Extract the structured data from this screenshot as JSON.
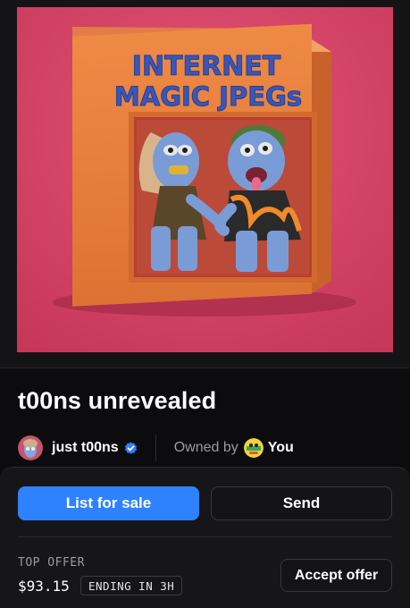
{
  "nft": {
    "box_text_line1": "INTERNET",
    "box_text_line2": "MAGIC JPEGs",
    "title": "t00ns unrevealed"
  },
  "creator": {
    "name": "just t00ns",
    "verified": true
  },
  "ownership": {
    "label": "Owned by",
    "owner": "You"
  },
  "actions": {
    "list_label": "List for sale",
    "send_label": "Send"
  },
  "offer": {
    "label": "TOP OFFER",
    "price": "$93.15",
    "ending": "ENDING IN 3H",
    "accept_label": "Accept offer"
  },
  "colors": {
    "accent": "#2f82ff",
    "background": "#0c0c0e",
    "media_bg": "#d94668",
    "box": "#e8813f"
  },
  "icons": {
    "verified": "verified-badge-icon"
  }
}
